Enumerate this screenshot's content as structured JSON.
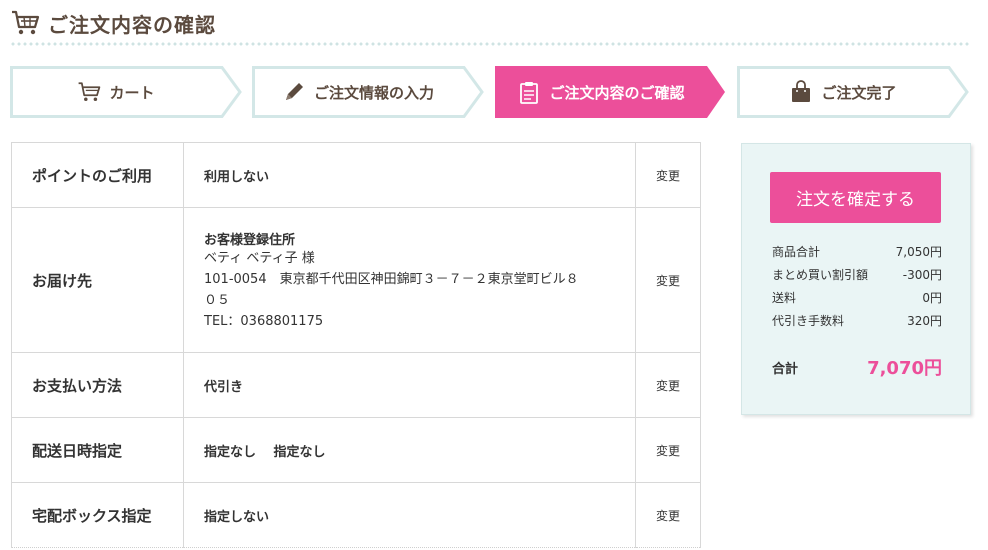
{
  "header": {
    "title": "ご注文内容の確認"
  },
  "steps": [
    {
      "label": "カート",
      "icon": "cart-icon"
    },
    {
      "label": "ご注文情報の入力",
      "icon": "pencil-icon"
    },
    {
      "label": "ご注文内容のご確認",
      "icon": "clipboard-icon"
    },
    {
      "label": "ご注文完了",
      "icon": "bag-icon"
    }
  ],
  "colors": {
    "accent": "#ec4f9a",
    "step_border": "#d3e7e7",
    "title": "#5b4a3e",
    "summary_bg": "#eaf5f5"
  },
  "order": {
    "change_label": "変更",
    "points": {
      "label": "ポイントのご利用",
      "value": "利用しない"
    },
    "delivery": {
      "label": "お届け先",
      "address_title": "お客様登録住所",
      "name": "ベティ ベティ子 様",
      "address_line1": "101-0054　東京都千代田区神田錦町３－７－２東京堂町ビル８",
      "address_line2": "０５",
      "tel": "TEL：0368801175"
    },
    "payment": {
      "label": "お支払い方法",
      "value": "代引き"
    },
    "datetime": {
      "label": "配送日時指定",
      "value": "指定なし　 指定なし"
    },
    "box": {
      "label": "宅配ボックス指定",
      "value": "指定しない"
    }
  },
  "summary": {
    "confirm_label": "注文を確定する",
    "rows": [
      {
        "label": "商品合計",
        "value": "7,050円"
      },
      {
        "label": "まとめ買い割引額",
        "value": "-300円"
      },
      {
        "label": "送料",
        "value": "0円"
      },
      {
        "label": "代引き手数料",
        "value": "320円"
      }
    ],
    "total_label": "合計",
    "total_value": "7,070円"
  }
}
